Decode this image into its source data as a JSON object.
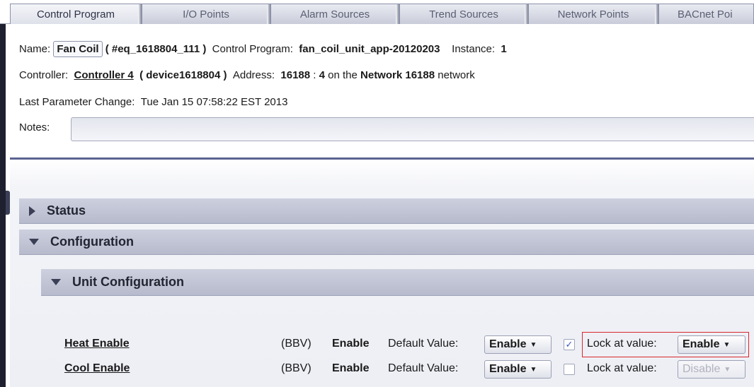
{
  "tabs": [
    {
      "label": "Control Program"
    },
    {
      "label": "I/O Points"
    },
    {
      "label": "Alarm Sources"
    },
    {
      "label": "Trend Sources"
    },
    {
      "label": "Network Points"
    },
    {
      "label": "BACnet Poi"
    }
  ],
  "header": {
    "name_label": "Name:",
    "name_value": "Fan Coil",
    "eq_id": "( #eq_1618804_111 )",
    "control_program_label": "Control Program:",
    "control_program_value": "fan_coil_unit_app-20120203",
    "instance_label": "Instance:",
    "instance_value": "1",
    "controller_label": "Controller:",
    "controller_value": "Controller 4",
    "device_id": "( device1618804 )",
    "address_label": "Address:",
    "address_net": "16188",
    "address_sep": " : ",
    "address_node": "4",
    "on_the": " on the ",
    "network_name": "Network 16188",
    "network_suffix": " network",
    "last_change_label": "Last Parameter Change:",
    "last_change_value": "Tue Jan 15 07:58:22 EST 2013",
    "notes_label": "Notes:",
    "notes_value": ""
  },
  "sections": {
    "status": "Status",
    "configuration": "Configuration",
    "unit_configuration": "Unit Configuration"
  },
  "params": [
    {
      "name": "Heat Enable",
      "type": "(BBV)",
      "value": "Enable",
      "default_label": "Default Value:",
      "default_value": "Enable",
      "lock_checked": true,
      "lock_label": "Lock at value:",
      "lock_value": "Enable"
    },
    {
      "name": "Cool Enable",
      "type": "(BBV)",
      "value": "Enable",
      "default_label": "Default Value:",
      "default_value": "Enable",
      "lock_checked": false,
      "lock_label": "Lock at value:",
      "lock_value": "Disable"
    }
  ],
  "icons": {
    "collapsed": "triangle-right-icon",
    "expanded": "triangle-down-icon",
    "dropdown": "caret-down-icon",
    "check": "✓"
  },
  "colors": {
    "highlight_border": "#d9262b",
    "divider": "#5a6490",
    "section_bg": "#c2c6d6"
  }
}
